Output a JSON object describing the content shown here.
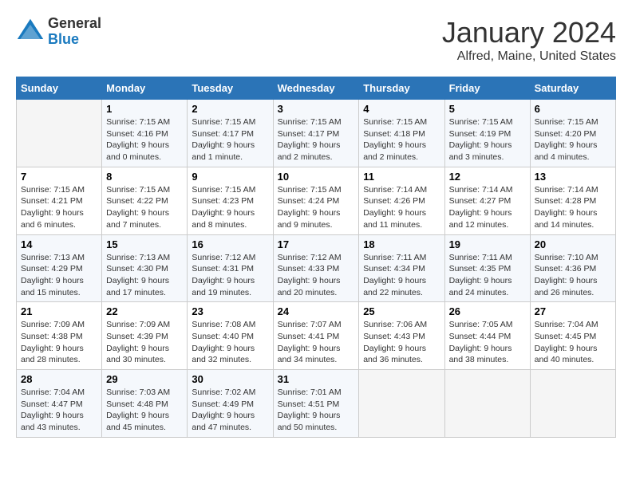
{
  "header": {
    "logo_general": "General",
    "logo_blue": "Blue",
    "title": "January 2024",
    "location": "Alfred, Maine, United States"
  },
  "days_header": [
    "Sunday",
    "Monday",
    "Tuesday",
    "Wednesday",
    "Thursday",
    "Friday",
    "Saturday"
  ],
  "weeks": [
    [
      {
        "day": "",
        "sunrise": "",
        "sunset": "",
        "daylight": ""
      },
      {
        "day": "1",
        "sunrise": "Sunrise: 7:15 AM",
        "sunset": "Sunset: 4:16 PM",
        "daylight": "Daylight: 9 hours and 0 minutes."
      },
      {
        "day": "2",
        "sunrise": "Sunrise: 7:15 AM",
        "sunset": "Sunset: 4:17 PM",
        "daylight": "Daylight: 9 hours and 1 minute."
      },
      {
        "day": "3",
        "sunrise": "Sunrise: 7:15 AM",
        "sunset": "Sunset: 4:17 PM",
        "daylight": "Daylight: 9 hours and 2 minutes."
      },
      {
        "day": "4",
        "sunrise": "Sunrise: 7:15 AM",
        "sunset": "Sunset: 4:18 PM",
        "daylight": "Daylight: 9 hours and 2 minutes."
      },
      {
        "day": "5",
        "sunrise": "Sunrise: 7:15 AM",
        "sunset": "Sunset: 4:19 PM",
        "daylight": "Daylight: 9 hours and 3 minutes."
      },
      {
        "day": "6",
        "sunrise": "Sunrise: 7:15 AM",
        "sunset": "Sunset: 4:20 PM",
        "daylight": "Daylight: 9 hours and 4 minutes."
      }
    ],
    [
      {
        "day": "7",
        "sunrise": "Sunrise: 7:15 AM",
        "sunset": "Sunset: 4:21 PM",
        "daylight": "Daylight: 9 hours and 6 minutes."
      },
      {
        "day": "8",
        "sunrise": "Sunrise: 7:15 AM",
        "sunset": "Sunset: 4:22 PM",
        "daylight": "Daylight: 9 hours and 7 minutes."
      },
      {
        "day": "9",
        "sunrise": "Sunrise: 7:15 AM",
        "sunset": "Sunset: 4:23 PM",
        "daylight": "Daylight: 9 hours and 8 minutes."
      },
      {
        "day": "10",
        "sunrise": "Sunrise: 7:15 AM",
        "sunset": "Sunset: 4:24 PM",
        "daylight": "Daylight: 9 hours and 9 minutes."
      },
      {
        "day": "11",
        "sunrise": "Sunrise: 7:14 AM",
        "sunset": "Sunset: 4:26 PM",
        "daylight": "Daylight: 9 hours and 11 minutes."
      },
      {
        "day": "12",
        "sunrise": "Sunrise: 7:14 AM",
        "sunset": "Sunset: 4:27 PM",
        "daylight": "Daylight: 9 hours and 12 minutes."
      },
      {
        "day": "13",
        "sunrise": "Sunrise: 7:14 AM",
        "sunset": "Sunset: 4:28 PM",
        "daylight": "Daylight: 9 hours and 14 minutes."
      }
    ],
    [
      {
        "day": "14",
        "sunrise": "Sunrise: 7:13 AM",
        "sunset": "Sunset: 4:29 PM",
        "daylight": "Daylight: 9 hours and 15 minutes."
      },
      {
        "day": "15",
        "sunrise": "Sunrise: 7:13 AM",
        "sunset": "Sunset: 4:30 PM",
        "daylight": "Daylight: 9 hours and 17 minutes."
      },
      {
        "day": "16",
        "sunrise": "Sunrise: 7:12 AM",
        "sunset": "Sunset: 4:31 PM",
        "daylight": "Daylight: 9 hours and 19 minutes."
      },
      {
        "day": "17",
        "sunrise": "Sunrise: 7:12 AM",
        "sunset": "Sunset: 4:33 PM",
        "daylight": "Daylight: 9 hours and 20 minutes."
      },
      {
        "day": "18",
        "sunrise": "Sunrise: 7:11 AM",
        "sunset": "Sunset: 4:34 PM",
        "daylight": "Daylight: 9 hours and 22 minutes."
      },
      {
        "day": "19",
        "sunrise": "Sunrise: 7:11 AM",
        "sunset": "Sunset: 4:35 PM",
        "daylight": "Daylight: 9 hours and 24 minutes."
      },
      {
        "day": "20",
        "sunrise": "Sunrise: 7:10 AM",
        "sunset": "Sunset: 4:36 PM",
        "daylight": "Daylight: 9 hours and 26 minutes."
      }
    ],
    [
      {
        "day": "21",
        "sunrise": "Sunrise: 7:09 AM",
        "sunset": "Sunset: 4:38 PM",
        "daylight": "Daylight: 9 hours and 28 minutes."
      },
      {
        "day": "22",
        "sunrise": "Sunrise: 7:09 AM",
        "sunset": "Sunset: 4:39 PM",
        "daylight": "Daylight: 9 hours and 30 minutes."
      },
      {
        "day": "23",
        "sunrise": "Sunrise: 7:08 AM",
        "sunset": "Sunset: 4:40 PM",
        "daylight": "Daylight: 9 hours and 32 minutes."
      },
      {
        "day": "24",
        "sunrise": "Sunrise: 7:07 AM",
        "sunset": "Sunset: 4:41 PM",
        "daylight": "Daylight: 9 hours and 34 minutes."
      },
      {
        "day": "25",
        "sunrise": "Sunrise: 7:06 AM",
        "sunset": "Sunset: 4:43 PM",
        "daylight": "Daylight: 9 hours and 36 minutes."
      },
      {
        "day": "26",
        "sunrise": "Sunrise: 7:05 AM",
        "sunset": "Sunset: 4:44 PM",
        "daylight": "Daylight: 9 hours and 38 minutes."
      },
      {
        "day": "27",
        "sunrise": "Sunrise: 7:04 AM",
        "sunset": "Sunset: 4:45 PM",
        "daylight": "Daylight: 9 hours and 40 minutes."
      }
    ],
    [
      {
        "day": "28",
        "sunrise": "Sunrise: 7:04 AM",
        "sunset": "Sunset: 4:47 PM",
        "daylight": "Daylight: 9 hours and 43 minutes."
      },
      {
        "day": "29",
        "sunrise": "Sunrise: 7:03 AM",
        "sunset": "Sunset: 4:48 PM",
        "daylight": "Daylight: 9 hours and 45 minutes."
      },
      {
        "day": "30",
        "sunrise": "Sunrise: 7:02 AM",
        "sunset": "Sunset: 4:49 PM",
        "daylight": "Daylight: 9 hours and 47 minutes."
      },
      {
        "day": "31",
        "sunrise": "Sunrise: 7:01 AM",
        "sunset": "Sunset: 4:51 PM",
        "daylight": "Daylight: 9 hours and 50 minutes."
      },
      {
        "day": "",
        "sunrise": "",
        "sunset": "",
        "daylight": ""
      },
      {
        "day": "",
        "sunrise": "",
        "sunset": "",
        "daylight": ""
      },
      {
        "day": "",
        "sunrise": "",
        "sunset": "",
        "daylight": ""
      }
    ]
  ]
}
